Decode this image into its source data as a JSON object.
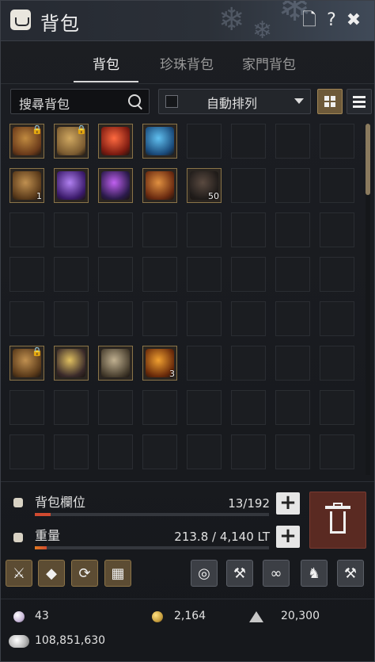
{
  "window": {
    "title": "背包",
    "buttons": [
      {
        "name": "document-icon",
        "glyph": "🗋"
      },
      {
        "name": "help-icon",
        "glyph": "?"
      },
      {
        "name": "close-icon",
        "glyph": "✖"
      }
    ]
  },
  "tabs": [
    {
      "label": "背包",
      "active": true
    },
    {
      "label": "珍珠背包",
      "active": false
    },
    {
      "label": "家門背包",
      "active": false
    }
  ],
  "search": {
    "placeholder": "搜尋背包"
  },
  "sort": {
    "label": "自動排列",
    "checked": false
  },
  "view_modes": [
    {
      "name": "grid-view-icon",
      "active": true
    },
    {
      "name": "list-view-icon",
      "active": false
    }
  ],
  "grid": {
    "columns": 8,
    "visible_rows": 8,
    "items": [
      {
        "slot": 0,
        "icon": "compass-relic-icon",
        "colors": [
          "#6a3a1a",
          "#c08a40"
        ],
        "locked": true
      },
      {
        "slot": 1,
        "icon": "treasure-map-icon",
        "colors": [
          "#7a5a30",
          "#d0a860"
        ],
        "locked": true
      },
      {
        "slot": 2,
        "icon": "red-elixir-icon",
        "colors": [
          "#7a1a10",
          "#ff6a40"
        ]
      },
      {
        "slot": 3,
        "icon": "blue-elixir-icon",
        "colors": [
          "#1a4a7a",
          "#60c0f0"
        ]
      },
      {
        "slot": 8,
        "icon": "treasure-chest-icon",
        "colors": [
          "#5a3a1a",
          "#c09050"
        ],
        "count": "1"
      },
      {
        "slot": 9,
        "icon": "purple-orb-icon",
        "colors": [
          "#3a1a6a",
          "#b080f0"
        ]
      },
      {
        "slot": 10,
        "icon": "arcane-blade-icon",
        "colors": [
          "#2a1a4a",
          "#c060f0"
        ]
      },
      {
        "slot": 11,
        "icon": "war-emblem-icon",
        "colors": [
          "#6a2a10",
          "#e09040"
        ]
      },
      {
        "slot": 12,
        "icon": "dark-stone-icon",
        "colors": [
          "#201c1a",
          "#5a4a40"
        ],
        "count": "50"
      },
      {
        "slot": 40,
        "icon": "spyglass-icon",
        "colors": [
          "#5a3a1a",
          "#c09050"
        ],
        "locked": true
      },
      {
        "slot": 41,
        "icon": "upgrade-sword-icon",
        "colors": [
          "#3a2a2a",
          "#e0c060"
        ]
      },
      {
        "slot": 42,
        "icon": "scroll-icon",
        "colors": [
          "#4a4030",
          "#c0b090"
        ]
      },
      {
        "slot": 43,
        "icon": "fire-orb-icon",
        "colors": [
          "#6a2a0a",
          "#f0a030"
        ],
        "count": "3"
      }
    ]
  },
  "capacity": {
    "slots": {
      "label": "背包欄位",
      "value": "13/192",
      "fill": 0.068,
      "color": "#d04a30"
    },
    "weight": {
      "label": "重量",
      "value": "213.8 / 4,140 LT",
      "fill": 0.052,
      "colors": [
        "#e07a20",
        "#d04a30"
      ]
    }
  },
  "tools_left": [
    {
      "name": "sparkle-sword-icon",
      "glyph": "⚔"
    },
    {
      "name": "diamond-icon",
      "glyph": "◆"
    },
    {
      "name": "recycle-icon",
      "glyph": "⟳"
    },
    {
      "name": "grid-menu-icon",
      "glyph": "▦"
    }
  ],
  "tools_right": [
    {
      "name": "lantern-icon",
      "glyph": "◎"
    },
    {
      "name": "hammer-icon",
      "glyph": "⚒"
    },
    {
      "name": "swirl-icon",
      "glyph": "∞"
    },
    {
      "name": "anvil-icon",
      "glyph": "♞"
    },
    {
      "name": "repair-hammer-icon",
      "glyph": "⚒"
    }
  ],
  "currency": {
    "pearls": {
      "icon": "pearl-icon",
      "value": "43",
      "color": "#c8b8d8"
    },
    "gold": {
      "icon": "gold-coin-icon",
      "value": "2,164",
      "color": "#c8a040"
    },
    "mileage": {
      "icon": "mileage-icon",
      "value": "20,300",
      "color": "#c8c8c8"
    },
    "silver": {
      "icon": "silver-icon",
      "value": "108,851,630",
      "color": "#b8b8b8"
    }
  }
}
